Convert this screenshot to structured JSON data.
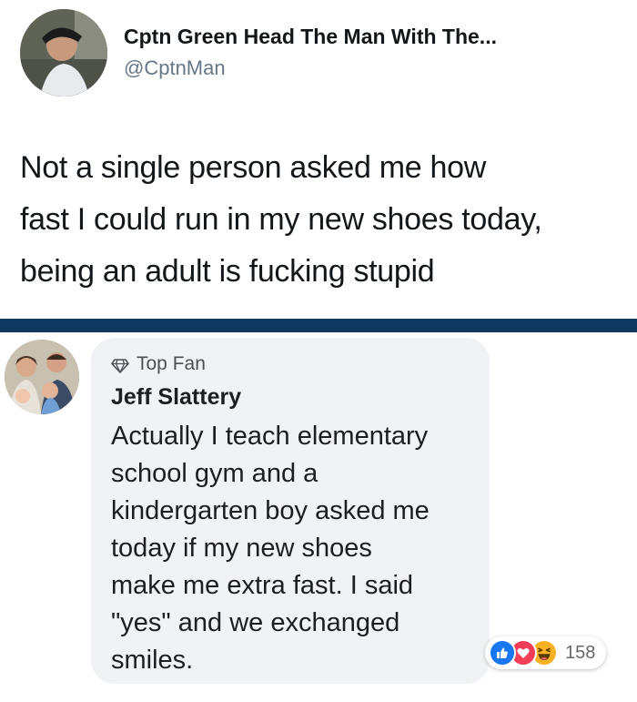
{
  "tweet": {
    "display_name": "Cptn Green Head The Man With The...",
    "handle": "@CptnMan",
    "text_lines": [
      "Not a single person asked me how",
      "fast I could run in my new shoes today,",
      "being an adult is fucking stupid"
    ]
  },
  "comment": {
    "badge_icon": "diamond-icon",
    "badge_label": "Top Fan",
    "author": "Jeff Slattery",
    "text_lines": [
      "Actually I teach elementary",
      "school gym and a",
      "kindergarten boy asked me",
      "today if my new shoes",
      "make me extra fast. I said",
      "\"yes\" and we exchanged",
      "smiles."
    ],
    "reactions": {
      "icons": [
        "like-icon",
        "love-icon",
        "haha-icon"
      ],
      "count": "158"
    }
  },
  "colors": {
    "divider": "#0f3960",
    "bubble": "#f0f2f5",
    "like": "#1877f2",
    "love": "#f33e58",
    "haha": "#f7b125",
    "handle": "#657786"
  }
}
